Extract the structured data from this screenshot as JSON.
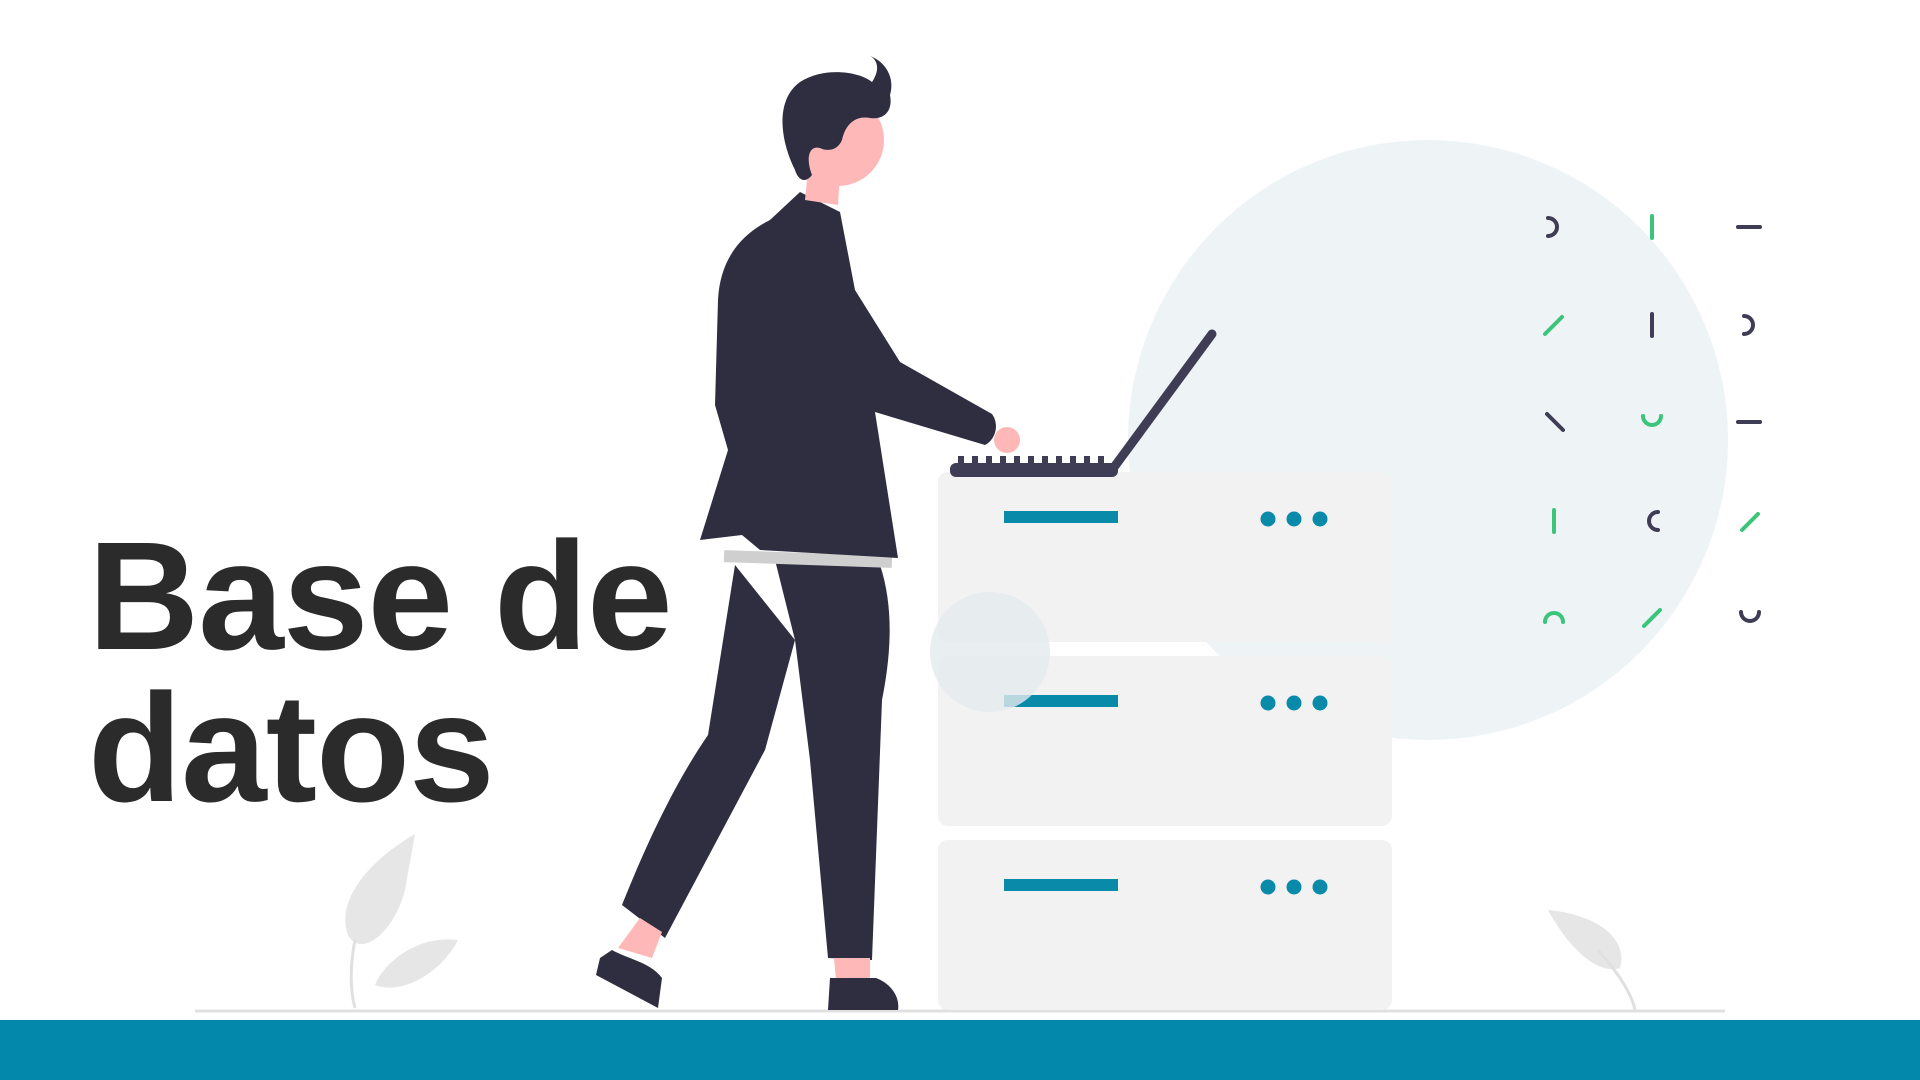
{
  "slide": {
    "title_line1": "Base de",
    "title_line2": "datos"
  },
  "colors": {
    "background": "#ffffff",
    "title": "#2b2b2b",
    "accent": "#0388ab",
    "server_bar": "#0a8aa9",
    "server_body": "#f2f2f2",
    "figure_dark": "#2f2e41",
    "skin": "#ffb8b8",
    "pattern_green": "#3cc47a",
    "pattern_dark": "#3f3d56",
    "circle": "#eef3f6",
    "leaf": "#e6e6e6"
  },
  "icons": {
    "person": "person-with-laptop-icon",
    "server": "server-rack-icon",
    "leaf": "leaf-icon",
    "pattern": "decorative-glyph-pattern"
  }
}
